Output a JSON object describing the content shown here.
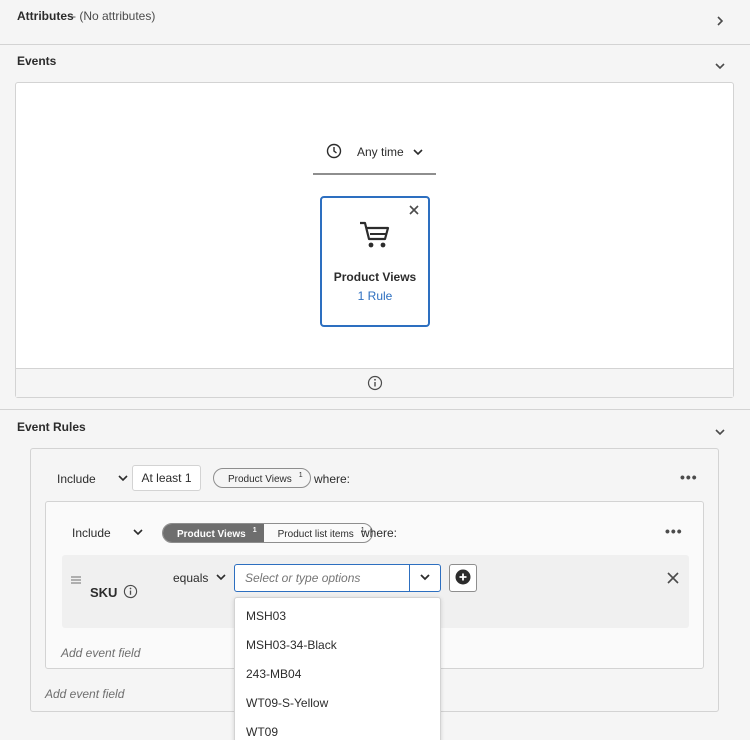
{
  "attributes": {
    "title": "Attributes",
    "suffix": " - (No attributes)"
  },
  "events": {
    "title": "Events",
    "time_filter": "Any time",
    "card": {
      "title": "Product Views",
      "rule_link": "1 Rule"
    }
  },
  "event_rules": {
    "title": "Event Rules",
    "outer": {
      "include_label": "Include",
      "count_label": "At least 1",
      "event_pill": "Product Views",
      "event_pill_sup": "1",
      "where": "where:"
    },
    "inner": {
      "include_label": "Include",
      "pill_selected": "Product Views",
      "pill_selected_sup": "1",
      "pill_other": "Product list items",
      "pill_other_sup": "1",
      "where": "where:",
      "field_label": "SKU",
      "operator": "equals",
      "value_placeholder": "Select or type options",
      "add_event_field": "Add event field"
    },
    "add_event_field": "Add event field"
  },
  "dropdown": {
    "options": [
      "MSH03",
      "MSH03-34-Black",
      "243-MB04",
      "WT09-S-Yellow",
      "WT09"
    ]
  },
  "colors": {
    "accent": "#2d6fc0",
    "link": "#2d6fc0"
  }
}
